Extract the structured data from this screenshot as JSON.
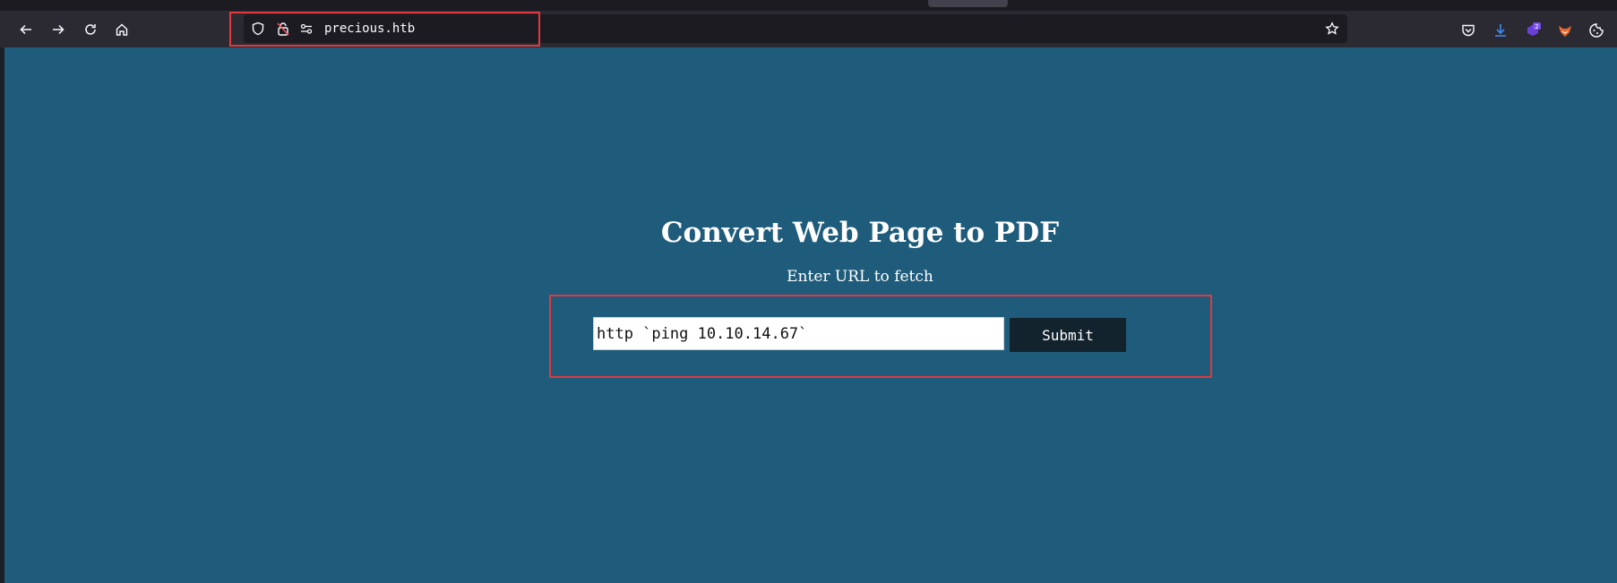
{
  "browser": {
    "url": "precious.htb",
    "nav": {
      "back_icon": "arrow-left-icon",
      "forward_icon": "arrow-right-icon",
      "reload_icon": "reload-icon",
      "home_icon": "home-icon"
    },
    "urlbar_icons": [
      "shield-icon",
      "lock-warning-icon",
      "permissions-icon"
    ],
    "bookmark_icon": "star-icon",
    "extensions": {
      "pocket_icon": "pocket-icon",
      "downloads_icon": "download-icon",
      "badge_count": "2",
      "foxyproxy_icon": "fox-icon",
      "cookie_icon": "cookie-icon"
    },
    "colors": {
      "highlight": "#e0393e",
      "accent_download": "#3c8ef5",
      "badge": "#6a3fd8"
    }
  },
  "page": {
    "title": "Convert Web Page to PDF",
    "subtitle": "Enter URL to fetch",
    "form": {
      "url_value": "http `ping 10.10.14.67`",
      "submit_label": "Submit"
    },
    "colors": {
      "background": "#1f5c7b",
      "button": "#13232e"
    }
  }
}
